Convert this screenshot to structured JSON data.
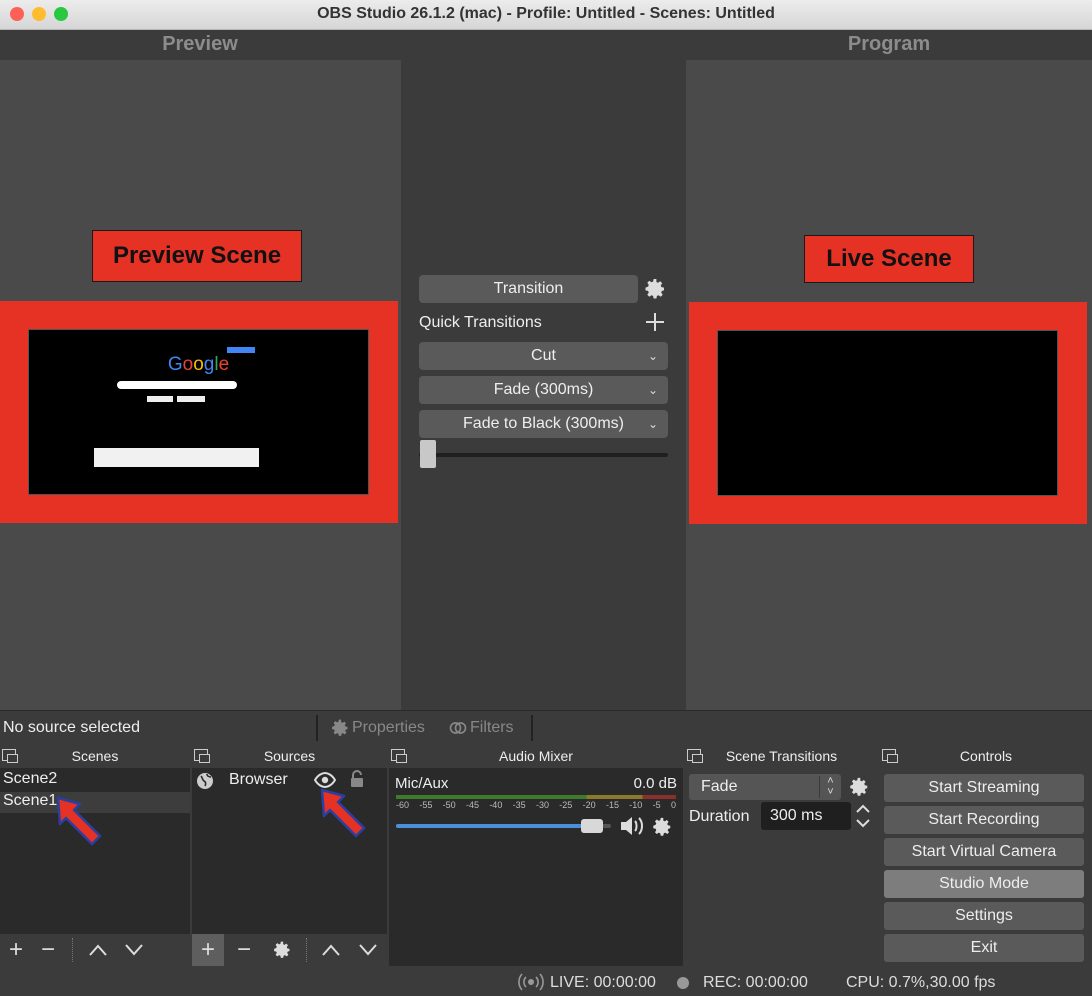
{
  "window": {
    "title": "OBS Studio 26.1.2 (mac) - Profile: Untitled - Scenes: Untitled",
    "traffic_colors": [
      "#fe5f57",
      "#febc2e",
      "#28c840"
    ]
  },
  "studio": {
    "preview_label": "Preview",
    "program_label": "Program",
    "preview_tag": "Preview Scene",
    "live_tag": "Live Scene",
    "google_logo": "Google",
    "accent_red": "#e53224"
  },
  "transitions_panel": {
    "transition_button": "Transition",
    "quick_transitions_label": "Quick Transitions",
    "items": [
      "Cut",
      "Fade (300ms)",
      "Fade to Black (300ms)"
    ]
  },
  "source_status": {
    "no_source": "No source selected",
    "properties": "Properties",
    "filters": "Filters"
  },
  "docks": {
    "scenes": {
      "title": "Scenes",
      "items": [
        "Scene2",
        "Scene1"
      ],
      "selected": "Scene1"
    },
    "sources": {
      "title": "Sources",
      "items": [
        {
          "name": "Browser",
          "icon": "globe-icon"
        }
      ]
    },
    "audio_mixer": {
      "title": "Audio Mixer",
      "channel": "Mic/Aux",
      "level": "0.0 dB",
      "ticks": [
        "-60",
        "-55",
        "-50",
        "-45",
        "-40",
        "-35",
        "-30",
        "-25",
        "-20",
        "-15",
        "-10",
        "-5",
        "0"
      ],
      "volume_fraction": 0.96
    },
    "scene_transitions": {
      "title": "Scene Transitions",
      "selected": "Fade",
      "duration_label": "Duration",
      "duration_value": "300 ms"
    },
    "controls": {
      "title": "Controls",
      "buttons": [
        "Start Streaming",
        "Start Recording",
        "Start Virtual Camera",
        "Studio Mode",
        "Settings",
        "Exit"
      ]
    }
  },
  "statusbar": {
    "live": "LIVE: 00:00:00",
    "rec": "REC: 00:00:00",
    "cpu": "CPU: 0.7%,30.00 fps"
  }
}
